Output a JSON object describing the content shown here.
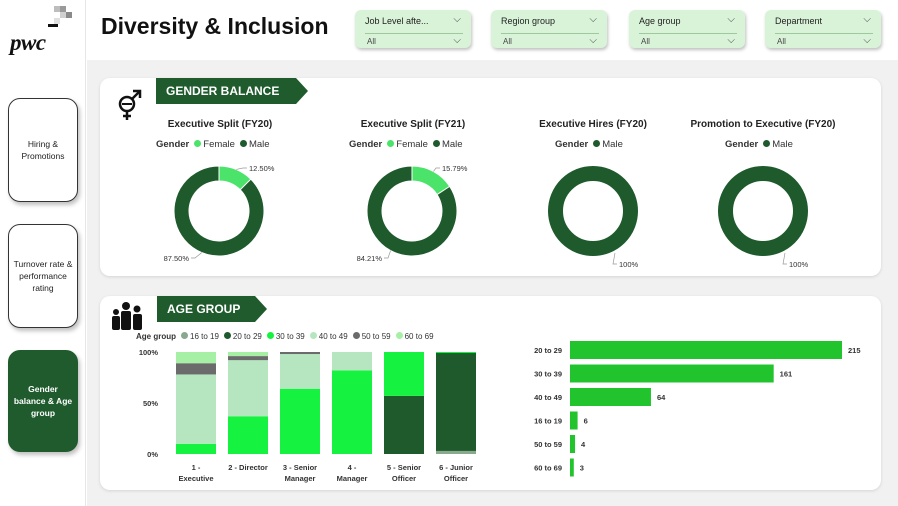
{
  "brand": {
    "logo_text": "pwc"
  },
  "nav": [
    {
      "label": "Hiring & Promotions",
      "active": false
    },
    {
      "label": "Turnover rate & performance rating",
      "active": false
    },
    {
      "label": "Gender balance & Age group",
      "active": true
    }
  ],
  "header": {
    "title": "Diversity & Inclusion"
  },
  "filters": [
    {
      "label": "Job Level afte...",
      "value": "All"
    },
    {
      "label": "Region group",
      "value": "All"
    },
    {
      "label": "Age group",
      "value": "All"
    },
    {
      "label": "Department",
      "value": "All"
    }
  ],
  "gender_section": {
    "title": "GENDER BALANCE",
    "legend_title": "Gender",
    "female_label": "Female",
    "male_label": "Male"
  },
  "age_section": {
    "title": "AGE GROUP",
    "legend_title": "Age group"
  },
  "colors": {
    "accent": "#1f5b2d",
    "male": "#1e5a2c",
    "female": "#4be36a",
    "age": {
      "16 to 19": "#8aa88e",
      "20 to 29": "#1e5a2c",
      "30 to 39": "#15f23f",
      "40 to 49": "#b5e6c0",
      "50 to 59": "#6b6b6b",
      "60 to 69": "#a6f0a6"
    },
    "bar": "#22c42e"
  },
  "chart_data": [
    {
      "type": "pie",
      "title": "Executive Split (FY20)",
      "legend": [
        "Female",
        "Male"
      ],
      "slices": [
        {
          "name": "Female",
          "value": 12.5,
          "label": "12.50%"
        },
        {
          "name": "Male",
          "value": 87.5,
          "label": "87.50%"
        }
      ]
    },
    {
      "type": "pie",
      "title": "Executive Split (FY21)",
      "legend": [
        "Female",
        "Male"
      ],
      "slices": [
        {
          "name": "Female",
          "value": 15.79,
          "label": "15.79%"
        },
        {
          "name": "Male",
          "value": 84.21,
          "label": "84.21%"
        }
      ]
    },
    {
      "type": "pie",
      "title": "Executive Hires (FY20)",
      "legend": [
        "Male"
      ],
      "slices": [
        {
          "name": "Male",
          "value": 100,
          "label": "100%"
        }
      ]
    },
    {
      "type": "pie",
      "title": "Promotion to Executive (FY20)",
      "legend": [
        "Male"
      ],
      "slices": [
        {
          "name": "Male",
          "value": 100,
          "label": "100%"
        }
      ]
    },
    {
      "type": "bar",
      "stacked": true,
      "orientation": "vertical",
      "categories": [
        "1 - Executive",
        "2 - Director",
        "3 - Senior Manager",
        "4 - Manager",
        "5 - Senior Officer",
        "6 - Junior Officer"
      ],
      "series": [
        {
          "name": "16 to 19",
          "values": [
            0,
            0,
            0,
            0,
            0,
            3
          ]
        },
        {
          "name": "20 to 29",
          "values": [
            0,
            0,
            0,
            0,
            57,
            96
          ]
        },
        {
          "name": "30 to 39",
          "values": [
            10,
            37,
            64,
            82,
            43,
            1
          ]
        },
        {
          "name": "40 to 49",
          "values": [
            68,
            55,
            34,
            18,
            0,
            0
          ]
        },
        {
          "name": "50 to 59",
          "values": [
            11,
            4,
            2,
            0,
            0,
            0
          ]
        },
        {
          "name": "60 to 69",
          "values": [
            11,
            4,
            0,
            0,
            0,
            0
          ]
        }
      ],
      "yticks": [
        "0%",
        "50%",
        "100%"
      ],
      "ylim": [
        0,
        100
      ]
    },
    {
      "type": "bar",
      "orientation": "horizontal",
      "categories": [
        "20 to 29",
        "30 to 39",
        "40 to 49",
        "16 to 19",
        "50 to 59",
        "60 to 69"
      ],
      "values": [
        215,
        161,
        64,
        6,
        4,
        3
      ],
      "xlim": [
        0,
        215
      ]
    }
  ]
}
